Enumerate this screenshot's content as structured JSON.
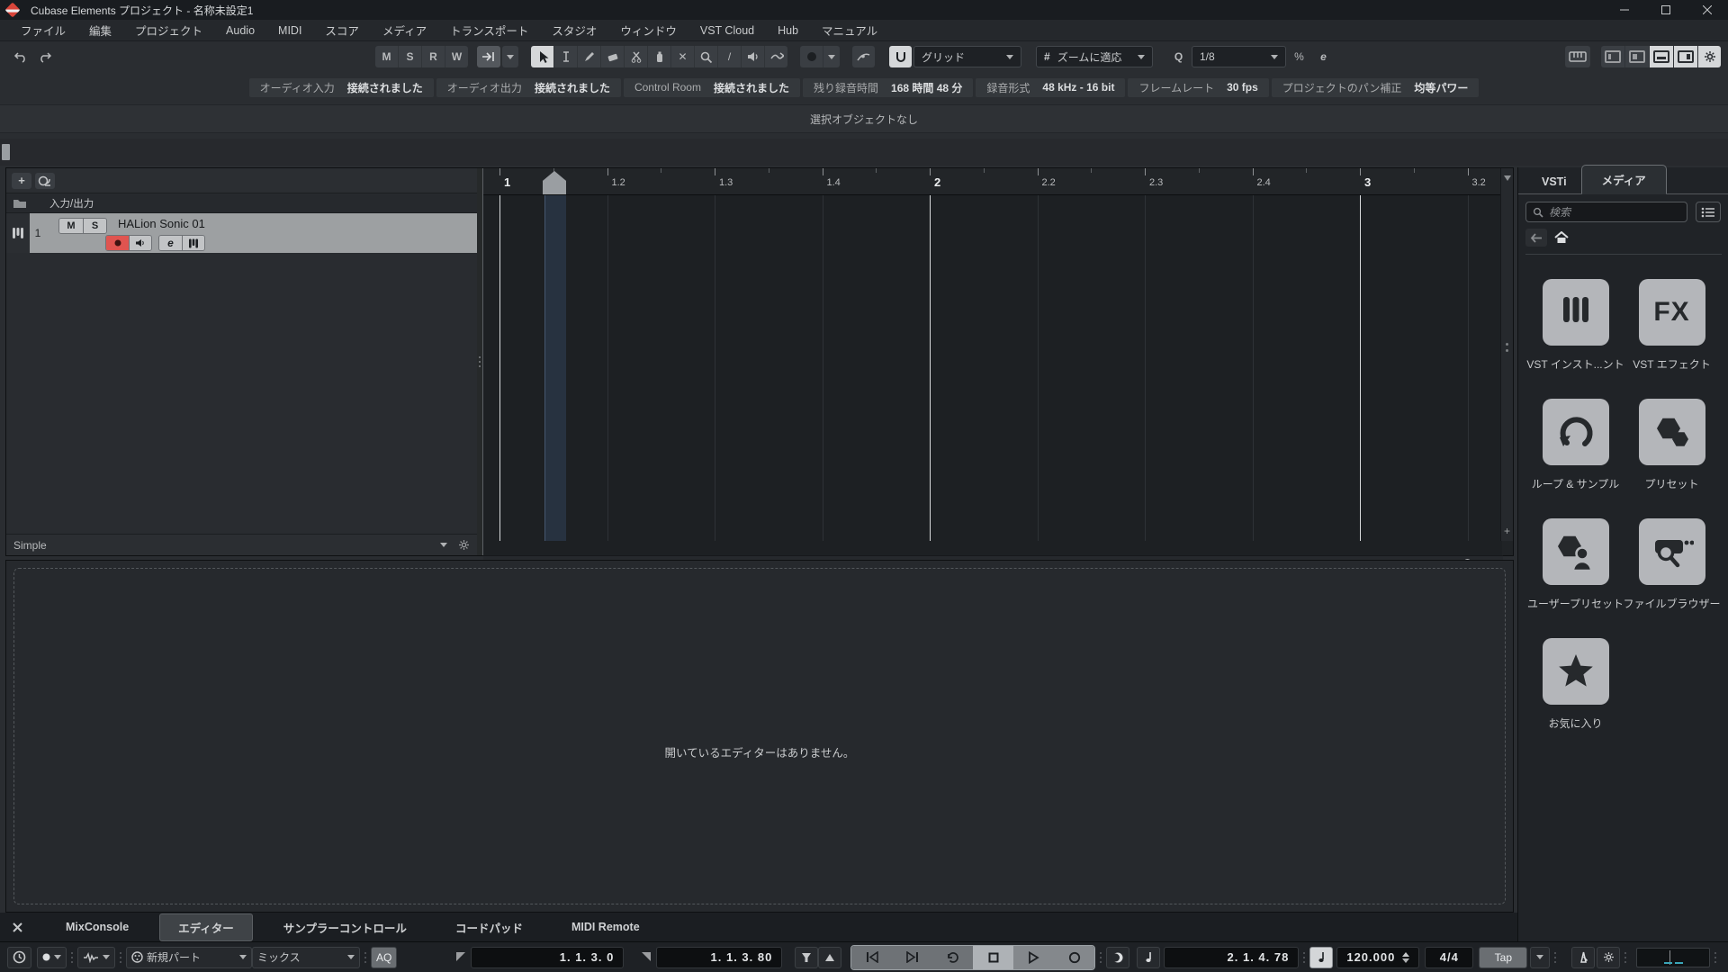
{
  "titlebar": {
    "title": "Cubase Elements プロジェクト - 名称未設定1"
  },
  "menubar": {
    "items": [
      "ファイル",
      "編集",
      "プロジェクト",
      "Audio",
      "MIDI",
      "スコア",
      "メディア",
      "トランスポート",
      "スタジオ",
      "ウィンドウ",
      "VST Cloud",
      "Hub",
      "マニュアル"
    ]
  },
  "toolbar": {
    "msrw": [
      "M",
      "S",
      "R",
      "W"
    ],
    "grid_mode": "グリッド",
    "zoom_mode": "ズームに適応",
    "quantize": "1/8",
    "glyphs": {
      "mute": "✕",
      "line": "/",
      "hash": "#",
      "q": "Q",
      "percent": "%",
      "e": "e"
    }
  },
  "infobar": {
    "chips": [
      {
        "label": "オーディオ入力",
        "value": "接続されました"
      },
      {
        "label": "オーディオ出力",
        "value": "接続されました"
      },
      {
        "label": "Control Room",
        "value": "接続されました"
      },
      {
        "label": "残り録音時間",
        "value": "168 時間 48 分"
      },
      {
        "label": "録音形式",
        "value": "48 kHz - 16 bit"
      },
      {
        "label": "フレームレート",
        "value": "30 fps"
      },
      {
        "label": "プロジェクトのパン補正",
        "value": "均等パワー"
      }
    ]
  },
  "statusline": {
    "text": "選択オブジェクトなし"
  },
  "track_panel": {
    "add_glyph": "+",
    "io_row": "入力/出力",
    "track_number": "1",
    "mute": "M",
    "solo": "S",
    "edit": "e",
    "track_name": "HALion Sonic 01",
    "preset_name": "Simple"
  },
  "ruler": {
    "ticks": [
      "1",
      "1.2",
      "1.3",
      "1.4",
      "2",
      "2.2",
      "2.3",
      "2.4",
      "3",
      "3.2"
    ]
  },
  "lower_zone": {
    "empty_message": "開いているエディターはありません。",
    "tabs": [
      "MixConsole",
      "エディター",
      "サンプラーコントロール",
      "コードパッド",
      "MIDI Remote"
    ],
    "active_tab": "エディター"
  },
  "right_zone": {
    "tabs": [
      "VSTi",
      "メディア"
    ],
    "active_tab": "メディア",
    "search_placeholder": "検索",
    "fx_glyph": "FX",
    "tiles": [
      {
        "icon": "piano",
        "label": "VST インスト...ント"
      },
      {
        "icon": "fx",
        "label": "VST エフェクト"
      },
      {
        "icon": "loop",
        "label": "ループ & サンプル"
      },
      {
        "icon": "preset",
        "label": "プリセット"
      },
      {
        "icon": "user",
        "label": "ユーザープリセット"
      },
      {
        "icon": "browser",
        "label": "ファイルブラウザー"
      },
      {
        "icon": "star",
        "label": "お気に入り"
      }
    ]
  },
  "transport": {
    "new_part": "新規パート",
    "mix": "ミックス",
    "aq": "AQ",
    "left_locator": "1. 1. 3. 0",
    "right_locator": "1. 1. 3. 80",
    "position": "2. 1. 4. 78",
    "tempo": "120.000",
    "time_sig": "4/4",
    "tap": "Tap"
  }
}
